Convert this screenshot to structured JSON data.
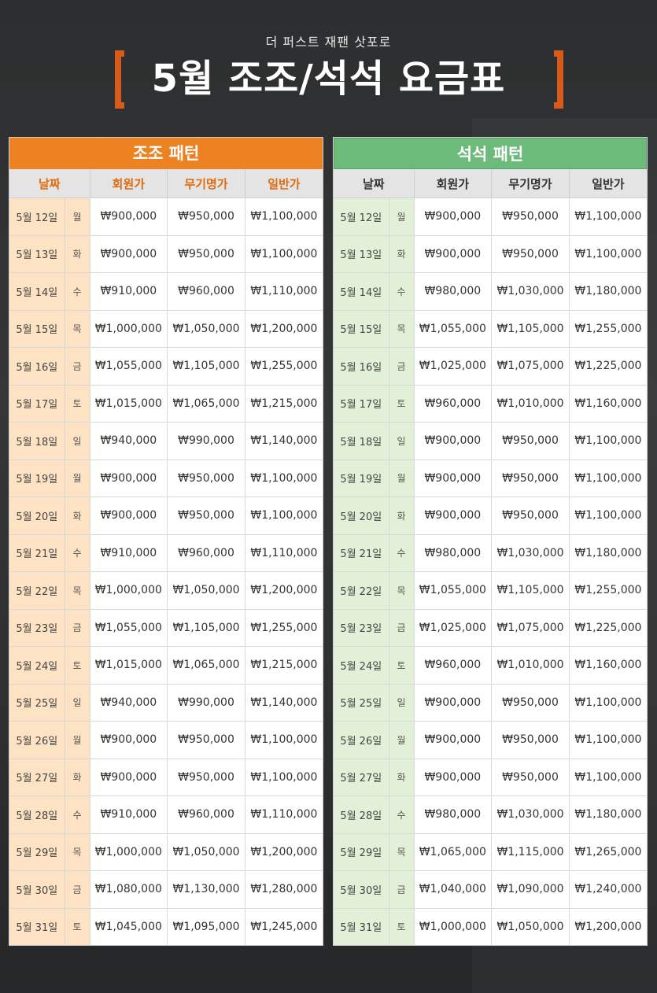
{
  "header": {
    "subtitle": "더 퍼스트 재팬 삿포로",
    "title": "5월 조조/석석 요금표",
    "accent_color": "#d65a1a"
  },
  "columns": {
    "date": "날짜",
    "member": "회원가",
    "gun": "무기명가",
    "general": "일반가"
  },
  "dates": [
    {
      "date": "5월 12일",
      "day": "월"
    },
    {
      "date": "5월 13일",
      "day": "화"
    },
    {
      "date": "5월 14일",
      "day": "수"
    },
    {
      "date": "5월 15일",
      "day": "목"
    },
    {
      "date": "5월 16일",
      "day": "금"
    },
    {
      "date": "5월 17일",
      "day": "토"
    },
    {
      "date": "5월 18일",
      "day": "일"
    },
    {
      "date": "5월 19일",
      "day": "월"
    },
    {
      "date": "5월 20일",
      "day": "화"
    },
    {
      "date": "5월 21일",
      "day": "수"
    },
    {
      "date": "5월 22일",
      "day": "목"
    },
    {
      "date": "5월 23일",
      "day": "금"
    },
    {
      "date": "5월 24일",
      "day": "토"
    },
    {
      "date": "5월 25일",
      "day": "일"
    },
    {
      "date": "5월 26일",
      "day": "월"
    },
    {
      "date": "5월 27일",
      "day": "화"
    },
    {
      "date": "5월 28일",
      "day": "수"
    },
    {
      "date": "5월 29일",
      "day": "목"
    },
    {
      "date": "5월 30일",
      "day": "금"
    },
    {
      "date": "5월 31일",
      "day": "토"
    }
  ],
  "morning": {
    "title": "조조 패턴",
    "color": "#ed8223",
    "rows": [
      [
        "₩900,000",
        "₩950,000",
        "₩1,100,000"
      ],
      [
        "₩900,000",
        "₩950,000",
        "₩1,100,000"
      ],
      [
        "₩910,000",
        "₩960,000",
        "₩1,110,000"
      ],
      [
        "₩1,000,000",
        "₩1,050,000",
        "₩1,200,000"
      ],
      [
        "₩1,055,000",
        "₩1,105,000",
        "₩1,255,000"
      ],
      [
        "₩1,015,000",
        "₩1,065,000",
        "₩1,215,000"
      ],
      [
        "₩940,000",
        "₩990,000",
        "₩1,140,000"
      ],
      [
        "₩900,000",
        "₩950,000",
        "₩1,100,000"
      ],
      [
        "₩900,000",
        "₩950,000",
        "₩1,100,000"
      ],
      [
        "₩910,000",
        "₩960,000",
        "₩1,110,000"
      ],
      [
        "₩1,000,000",
        "₩1,050,000",
        "₩1,200,000"
      ],
      [
        "₩1,055,000",
        "₩1,105,000",
        "₩1,255,000"
      ],
      [
        "₩1,015,000",
        "₩1,065,000",
        "₩1,215,000"
      ],
      [
        "₩940,000",
        "₩990,000",
        "₩1,140,000"
      ],
      [
        "₩900,000",
        "₩950,000",
        "₩1,100,000"
      ],
      [
        "₩900,000",
        "₩950,000",
        "₩1,100,000"
      ],
      [
        "₩910,000",
        "₩960,000",
        "₩1,110,000"
      ],
      [
        "₩1,000,000",
        "₩1,050,000",
        "₩1,200,000"
      ],
      [
        "₩1,080,000",
        "₩1,130,000",
        "₩1,280,000"
      ],
      [
        "₩1,045,000",
        "₩1,095,000",
        "₩1,245,000"
      ]
    ]
  },
  "evening": {
    "title": "석석 패턴",
    "color": "#6dbb7b",
    "rows": [
      [
        "₩900,000",
        "₩950,000",
        "₩1,100,000"
      ],
      [
        "₩900,000",
        "₩950,000",
        "₩1,100,000"
      ],
      [
        "₩980,000",
        "₩1,030,000",
        "₩1,180,000"
      ],
      [
        "₩1,055,000",
        "₩1,105,000",
        "₩1,255,000"
      ],
      [
        "₩1,025,000",
        "₩1,075,000",
        "₩1,225,000"
      ],
      [
        "₩960,000",
        "₩1,010,000",
        "₩1,160,000"
      ],
      [
        "₩900,000",
        "₩950,000",
        "₩1,100,000"
      ],
      [
        "₩900,000",
        "₩950,000",
        "₩1,100,000"
      ],
      [
        "₩900,000",
        "₩950,000",
        "₩1,100,000"
      ],
      [
        "₩980,000",
        "₩1,030,000",
        "₩1,180,000"
      ],
      [
        "₩1,055,000",
        "₩1,105,000",
        "₩1,255,000"
      ],
      [
        "₩1,025,000",
        "₩1,075,000",
        "₩1,225,000"
      ],
      [
        "₩960,000",
        "₩1,010,000",
        "₩1,160,000"
      ],
      [
        "₩900,000",
        "₩950,000",
        "₩1,100,000"
      ],
      [
        "₩900,000",
        "₩950,000",
        "₩1,100,000"
      ],
      [
        "₩900,000",
        "₩950,000",
        "₩1,100,000"
      ],
      [
        "₩980,000",
        "₩1,030,000",
        "₩1,180,000"
      ],
      [
        "₩1,065,000",
        "₩1,115,000",
        "₩1,265,000"
      ],
      [
        "₩1,040,000",
        "₩1,090,000",
        "₩1,240,000"
      ],
      [
        "₩1,000,000",
        "₩1,050,000",
        "₩1,200,000"
      ]
    ]
  }
}
